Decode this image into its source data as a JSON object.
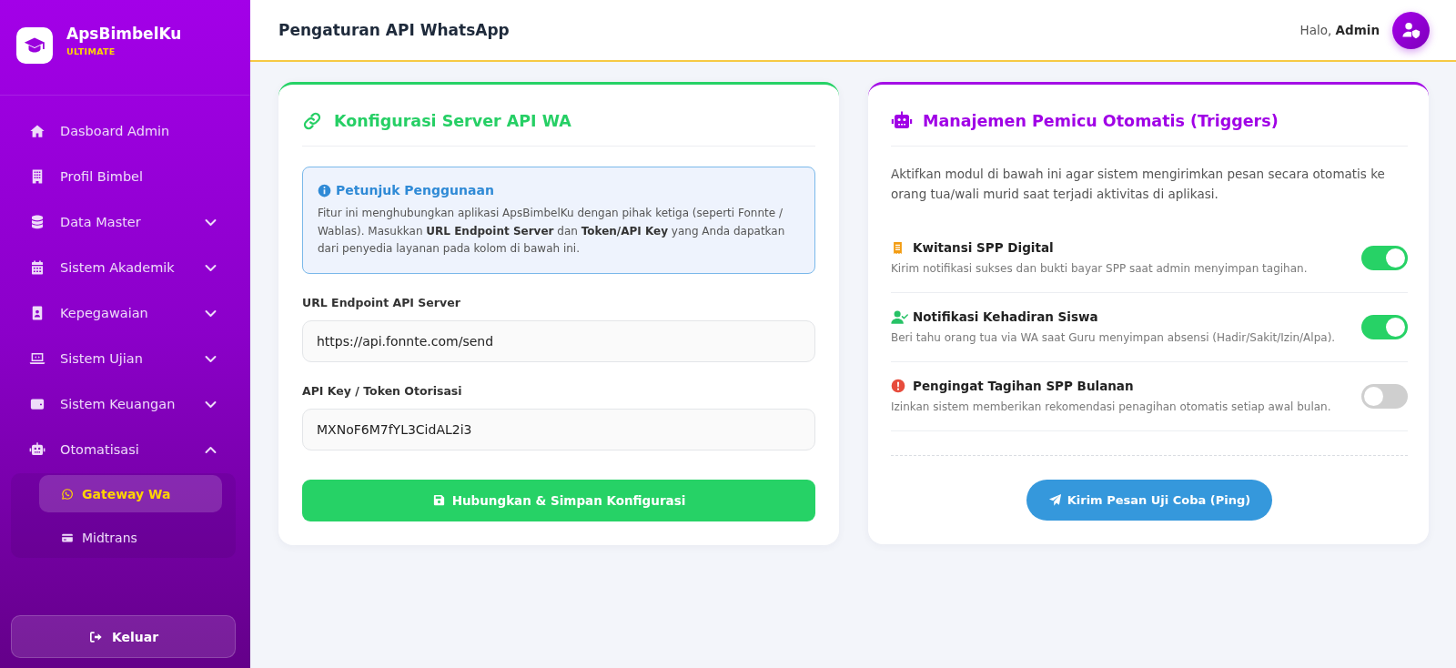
{
  "sidebar": {
    "brand": {
      "name": "ApsBimbelKu",
      "edition": "ULTIMATE"
    },
    "menu": [
      {
        "kind": "link",
        "label": "Dasboard Admin",
        "selected": false
      },
      {
        "kind": "link",
        "label": "Profil Bimbel",
        "selected": false
      },
      {
        "kind": "group",
        "label": "Data Master",
        "selected": false,
        "expanded": false
      },
      {
        "kind": "group",
        "label": "Sistem Akademik",
        "selected": false,
        "expanded": false
      },
      {
        "kind": "group",
        "label": "Kepegawaian",
        "selected": false,
        "expanded": false
      },
      {
        "kind": "group",
        "label": "Sistem Ujian",
        "selected": false,
        "expanded": false
      },
      {
        "kind": "group",
        "label": "Sistem Keuangan",
        "selected": false,
        "expanded": false
      },
      {
        "kind": "group",
        "label": "Otomatisasi",
        "selected": false,
        "expanded": true,
        "children": [
          {
            "label": "Gateway Wa",
            "selected": true
          },
          {
            "label": "Midtrans",
            "selected": false
          }
        ]
      }
    ],
    "logout": "Keluar"
  },
  "header": {
    "title": "Pengaturan API WhatsApp",
    "greeting": "Halo, **Admin**"
  },
  "config_card": {
    "title": "Konfigurasi Server API WA",
    "info": {
      "title": "Petunjuk Penggunaan",
      "text": "Fitur ini menghubungkan aplikasi ApsBimbelKu dengan pihak ketiga (seperti Fonnte / Wablas). Masukkan **URL Endpoint Server** dan **Token/API Key** yang Anda dapatkan dari penyedia layanan pada kolom di bawah ini."
    },
    "fields": [
      {
        "label": "URL Endpoint API Server",
        "value": "https://api.fonnte.com/send"
      },
      {
        "label": "API Key / Token Otorisasi",
        "value": "MXNoF6M7fYL3CidAL2i3"
      }
    ],
    "submit": "Hubungkan & Simpan Konfigurasi"
  },
  "triggers_card": {
    "title": "Manajemen Pemicu Otomatis (Triggers)",
    "description": "Aktifkan modul di bawah ini agar sistem mengirimkan pesan secara otomatis ke orang tua/wali murid saat terjadi aktivitas di aplikasi.",
    "triggers": [
      {
        "title": "Kwitansi SPP Digital",
        "description": "Kirim notifikasi sukses dan bukti bayar SPP saat admin menyimpan tagihan.",
        "on": true
      },
      {
        "title": "Notifikasi Kehadiran Siswa",
        "description": "Beri tahu orang tua via WA saat Guru menyimpan absensi (Hadir/Sakit/Izin/Alpa).",
        "on": true
      },
      {
        "title": "Pengingat Tagihan SPP Bulanan",
        "description": "Izinkan sistem memberikan rekomendasi penagihan otomatis setiap awal bulan.",
        "on": false
      }
    ],
    "ping_button": "Kirim Pesan Uji Coba (Ping)"
  }
}
